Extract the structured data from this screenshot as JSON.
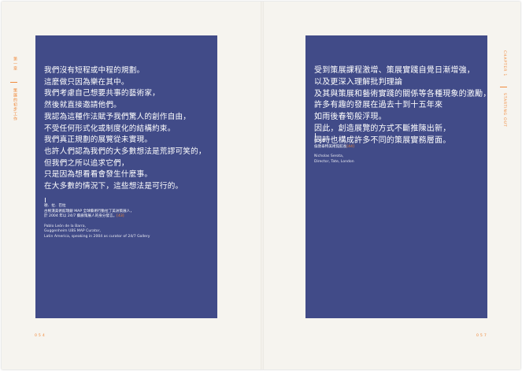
{
  "left_page": {
    "side_chapter": "第一章",
    "side_title": "策展的初步工作",
    "quote_lines": [
      "我們沒有短程或中程的規劃。",
      "這麼做只因為樂在其中。",
      "我們考慮自己想要共事的藝術家，",
      "然後就直接邀請他們。",
      "我認為這種作法賦予我們驚人的創作自由，",
      "不受任何形式化或制度化的結構約束。",
      "我們真正規劃的展覽從未實現。",
      "也許人們認為我們的大多數想法是荒謬可笑的，",
      "但我們之所以追求它們，",
      "只是因為想看看會發生什麼事。",
      "在大多數的情況下，這些想法是可行的。"
    ],
    "attribution_name": "德．拉．巴拉",
    "attribution_role_1": "古根漢美術館瑞銀 MAP 全球藝術行動拉丁美洲策展人，",
    "attribution_role_2": "於 2004 年以 24/7 藝廊策展人的身分發言。",
    "attribution_ref": "[43]",
    "en_line_1": "Pablo León de la Barra,",
    "en_line_2": "Guggenheim UBS MAP Curator,",
    "en_line_3": "Latin America, speaking in 2004 as curator of 24/7 Gallery",
    "page_number": "054"
  },
  "right_page": {
    "side_chapter": "CHAPTER 1",
    "side_title": "STARTING OUT",
    "quote_lines": [
      "受到策展課程激增、策展實踐自覺日漸增強，",
      "以及更深入理解批判理論",
      "及其與策展和藝術實踐的關係等各種現象的激勵，",
      "許多有趣的發展在過去十到十五年來",
      "如雨後春筍般浮現。",
      "因此，創造展覽的方式不斷推陳出新，",
      "同時也構成許多不同的策展實務層面。"
    ],
    "attribution_name": "蔡洛塔",
    "attribution_role_1": "倫敦泰特美術館館長",
    "attribution_ref": "[44]",
    "en_line_1": "Nicholas Serota,",
    "en_line_2": "Director, Tate, London",
    "page_number": "057"
  },
  "colors": {
    "panel": "#414b88",
    "accent": "#f08a3c",
    "paper": "#f6f4ef"
  }
}
